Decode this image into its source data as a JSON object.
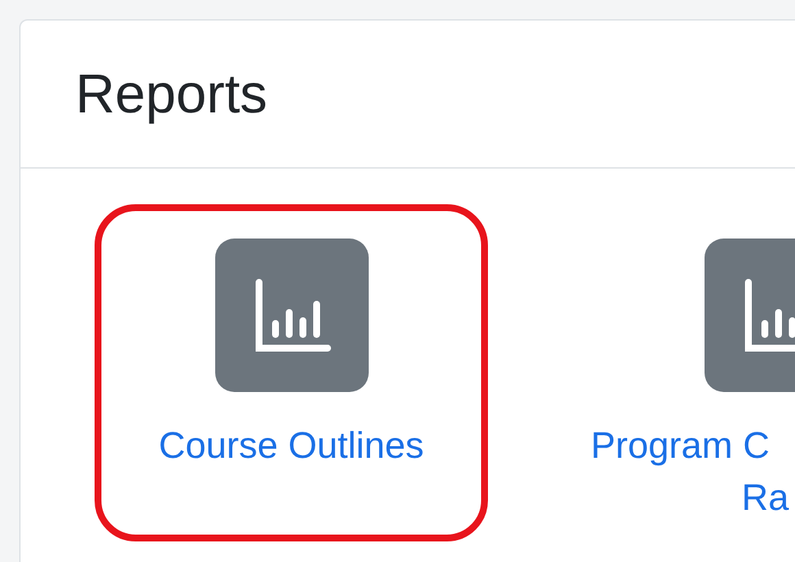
{
  "card": {
    "title": "Reports"
  },
  "items": [
    {
      "label_lines": [
        "Course Outlines"
      ],
      "highlighted": true
    },
    {
      "label_lines": [
        "Program C",
        "Ra"
      ],
      "highlighted": false
    }
  ]
}
